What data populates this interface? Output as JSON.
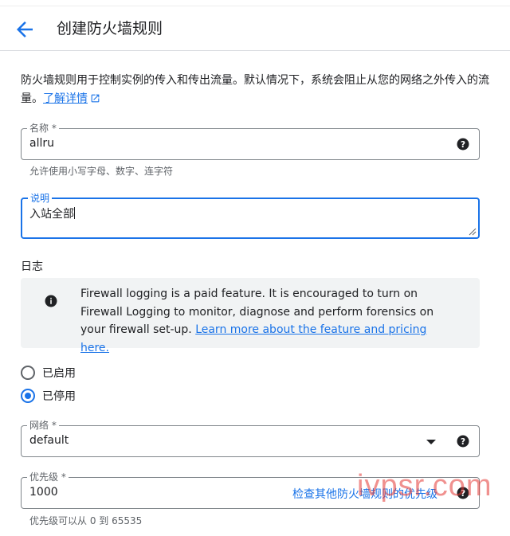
{
  "header": {
    "title": "创建防火墙规则"
  },
  "intro": {
    "text": "防火墙规则用于控制实例的传入和传出流量。默认情况下，系统会阻止从您的网络之外传入的流量。",
    "link": "了解详情"
  },
  "name_field": {
    "label": "名称 *",
    "value": "allru",
    "hint": "允许使用小写字母、数字、连字符"
  },
  "description_field": {
    "label": "说明",
    "value": "入站全部"
  },
  "logs": {
    "label": "日志",
    "info_text": "Firewall logging is a paid feature. It is encouraged to turn on Firewall Logging to monitor, diagnose and perform forensics on your firewall set-up.",
    "info_link": "Learn more about the feature and pricing here.",
    "options": [
      {
        "label": "已启用",
        "checked": false
      },
      {
        "label": "已停用",
        "checked": true
      }
    ]
  },
  "network_field": {
    "label": "网络 *",
    "value": "default"
  },
  "priority_field": {
    "label": "优先级 *",
    "value": "1000",
    "link": "检查其他防火墙规则的优先级",
    "hint": "优先级可以从 0 到 65535"
  },
  "watermark": "ivpsr.com",
  "colors": {
    "accent": "#1a73e8",
    "text": "#202124",
    "secondary": "#5f6368",
    "info_bg": "#f1f3f4"
  }
}
